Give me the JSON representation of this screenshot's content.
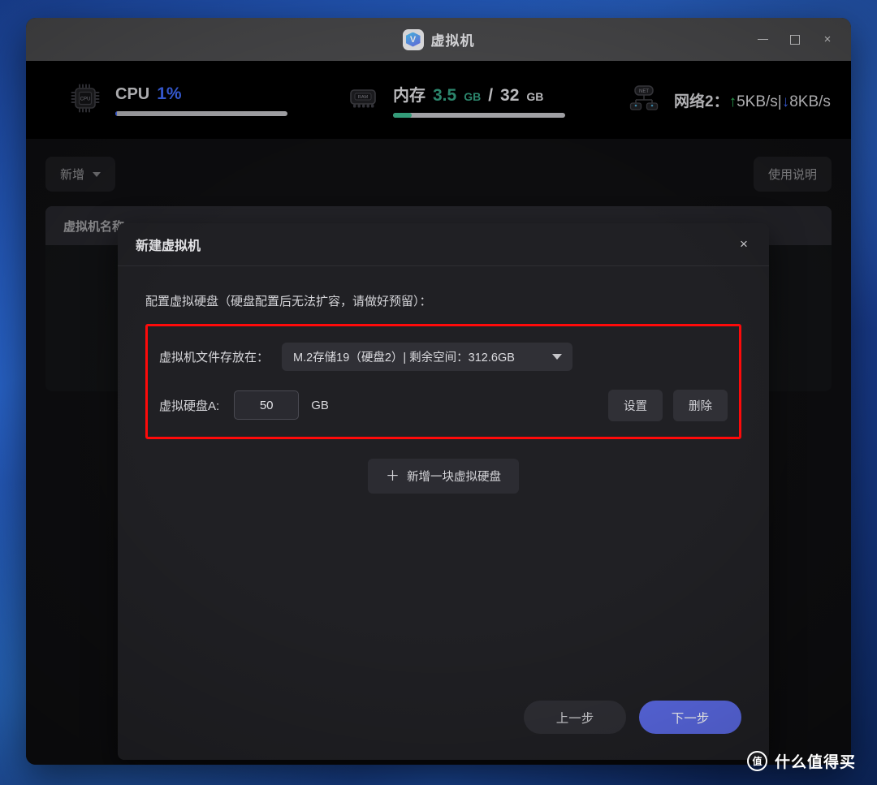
{
  "window": {
    "title": "虚拟机",
    "logo_letter": "V",
    "controls": {
      "minimize": "minimize-icon",
      "maximize": "maximize-icon",
      "close": "×"
    }
  },
  "stats": {
    "cpu": {
      "label": "CPU",
      "value": "1%",
      "percent": 1,
      "color": "#3b63e8",
      "bar_color": "#3b63e8",
      "icon": "cpu-chip-icon",
      "icon_text": "CPU"
    },
    "memory": {
      "label": "内存",
      "used": "3.5",
      "used_unit": "GB",
      "separator": "/",
      "total": "32",
      "total_unit": "GB",
      "percent": 11,
      "color": "#2f8f74",
      "bar_color": "#35a37f",
      "icon": "ram-chip-icon",
      "icon_text": "RAM"
    },
    "network": {
      "label": "网络2：",
      "up_arrow": "↑",
      "up_speed": "5KB/s",
      "divider": "|",
      "down_arrow": "↓",
      "down_speed": "8KB/s",
      "icon": "network-icon",
      "icon_text": "NET"
    }
  },
  "toolbar": {
    "add_label": "新增",
    "help_label": "使用说明"
  },
  "vm_table": {
    "columns": [
      "虚拟机名称"
    ]
  },
  "dialog": {
    "title": "新建虚拟机",
    "close_label": "×",
    "section_note": "配置虚拟硬盘（硬盘配置后无法扩容，请做好预留）：",
    "storage": {
      "label": "虚拟机文件存放在：",
      "selected": "M.2存储19（硬盘2）| 剩余空间：312.6GB"
    },
    "disk": {
      "label": "虚拟硬盘A:",
      "size_value": "50",
      "unit": "GB",
      "settings_label": "设置",
      "delete_label": "删除"
    },
    "add_disk_label": "新增一块虚拟硬盘",
    "add_disk_plus": "＋",
    "footer": {
      "prev_label": "上一步",
      "next_label": "下一步",
      "next_color": "#5b6ae6"
    },
    "highlight_color": "#ff0a0a"
  },
  "watermark": {
    "logo_text": "值",
    "text": "什么值得买"
  }
}
